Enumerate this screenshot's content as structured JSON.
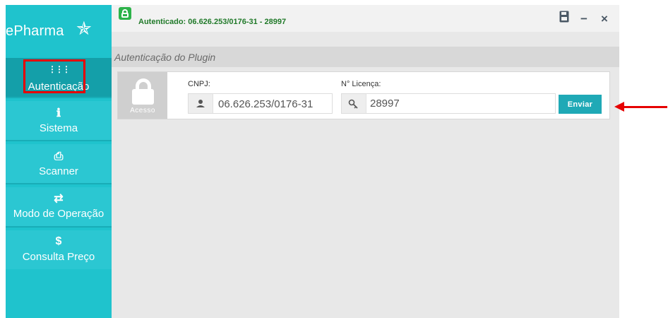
{
  "brand": {
    "name": "ePharma",
    "logo_icon": "star-icon"
  },
  "topbar": {
    "auth_status": "Autenticado: 06.626.253/0176-31 - 28997",
    "status_color": "#217a2a",
    "status_icon": "lock-open-icon",
    "save_icon": "save-icon",
    "minimize_label": "−",
    "close_label": "×"
  },
  "sidebar": {
    "accent_color": "#1fc3cd",
    "items": [
      {
        "label": "Autenticação",
        "icon": "grid-icon",
        "glyph": "⋮⋮⋮",
        "active": true
      },
      {
        "label": "Sistema",
        "icon": "info-icon",
        "glyph": "ℹ",
        "active": false
      },
      {
        "label": "Scanner",
        "icon": "printer-icon",
        "glyph": "⎙",
        "active": false
      },
      {
        "label": "Modo de Operação",
        "icon": "swap-icon",
        "glyph": "⇄",
        "active": false
      },
      {
        "label": "Consulta Preço",
        "icon": "dollar-icon",
        "glyph": "$",
        "active": false
      }
    ]
  },
  "header": {
    "title": "Autenticação do Plugin"
  },
  "auth_panel": {
    "lock_label": "Acesso",
    "cnpj_label": "CNPJ:",
    "cnpj_value": "06.626.253/0176-31",
    "cnpj_icon": "user-icon",
    "license_label": "N° Licença:",
    "license_value": "28997",
    "license_icon": "key-icon",
    "send_label": "Enviar",
    "button_color": "#1fa9b6"
  },
  "annotation": {
    "color": "#e60000"
  }
}
